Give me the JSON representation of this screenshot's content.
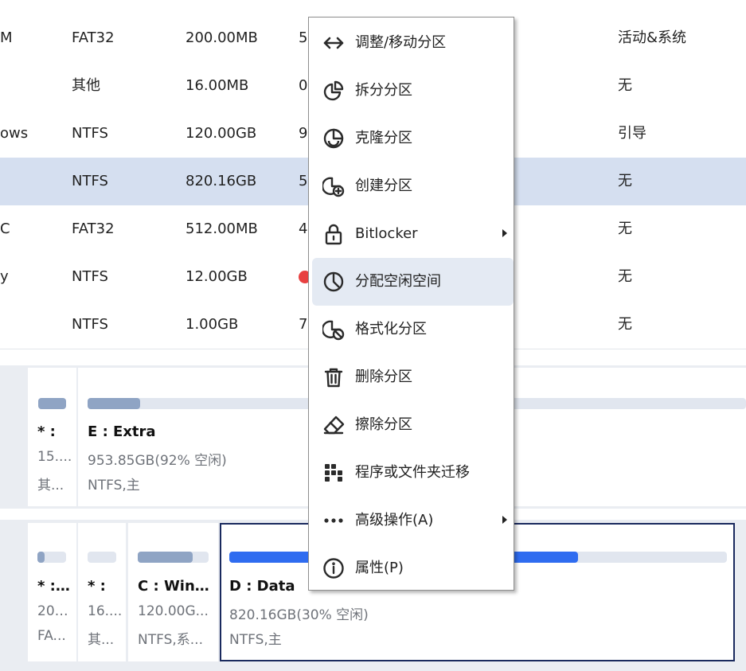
{
  "partition_table": {
    "rows": [
      {
        "name": "M",
        "fs": "FAT32",
        "size": "200.00MB",
        "used": "5",
        "type": "活动&系统",
        "selected": false
      },
      {
        "name": "",
        "fs": "其他",
        "size": "16.00MB",
        "used": "0",
        "type": "无",
        "selected": false
      },
      {
        "name": "ows",
        "fs": "NTFS",
        "size": "120.00GB",
        "used": "9",
        "type": "引导",
        "selected": false
      },
      {
        "name": "",
        "fs": "NTFS",
        "size": "820.16GB",
        "used": "5",
        "type": "无",
        "selected": true
      },
      {
        "name": "C",
        "fs": "FAT32",
        "size": "512.00MB",
        "used": "4",
        "type": "无",
        "selected": false
      },
      {
        "name": "y",
        "fs": "NTFS",
        "size": "12.00GB",
        "used": "",
        "type": "无",
        "selected": false
      },
      {
        "name": "",
        "fs": "NTFS",
        "size": "1.00GB",
        "used": "7",
        "type": "无",
        "selected": false
      }
    ]
  },
  "disk1": {
    "cards": [
      {
        "title": "* :",
        "size": "15....",
        "fs": "其...",
        "usage_fraction": 1.0
      },
      {
        "title": "E : Extra",
        "size": "953.85GB(92% 空闲)",
        "fs": "NTFS,主",
        "usage_fraction": 0.08
      }
    ]
  },
  "disk2": {
    "cards": [
      {
        "title": "* : ...",
        "size": "200....",
        "fs": "FA...",
        "usage_fraction": 0.25
      },
      {
        "title": "* :",
        "size": "16....",
        "fs": "其...",
        "usage_fraction": 0.0
      },
      {
        "title": "C : Wind...",
        "size": "120.00G...",
        "fs": "NTFS,系...",
        "usage_fraction": 0.78
      },
      {
        "title": "D : Data",
        "size": "820.16GB(30% 空闲)",
        "fs": "NTFS,主",
        "usage_fraction": 0.7
      }
    ]
  },
  "context_menu": {
    "items": [
      {
        "label": "调整/移动分区",
        "icon": "resize-move-icon",
        "submenu": false,
        "hover": false
      },
      {
        "label": "拆分分区",
        "icon": "split-partition-icon",
        "submenu": false,
        "hover": false
      },
      {
        "label": "克隆分区",
        "icon": "clone-partition-icon",
        "submenu": false,
        "hover": false
      },
      {
        "label": "创建分区",
        "icon": "create-partition-icon",
        "submenu": false,
        "hover": false
      },
      {
        "label": "Bitlocker",
        "icon": "lock-icon",
        "submenu": true,
        "hover": false
      },
      {
        "label": "分配空闲空间",
        "icon": "allocate-space-icon",
        "submenu": false,
        "hover": true
      },
      {
        "label": "格式化分区",
        "icon": "format-partition-icon",
        "submenu": false,
        "hover": false
      },
      {
        "label": "删除分区",
        "icon": "trash-icon",
        "submenu": false,
        "hover": false
      },
      {
        "label": "擦除分区",
        "icon": "eraser-icon",
        "submenu": false,
        "hover": false
      },
      {
        "label": "程序或文件夹迁移",
        "icon": "migrate-grid-icon",
        "submenu": false,
        "hover": false
      },
      {
        "label": "高级操作(A)",
        "icon": "more-dots-icon",
        "submenu": true,
        "hover": false
      },
      {
        "label": "属性(P)",
        "icon": "info-icon",
        "submenu": false,
        "hover": false
      }
    ]
  },
  "colors": {
    "selected_row": "#d5dff0",
    "menu_hover": "#e4eaf3",
    "usage_gray": "#8fa4c4",
    "usage_blue": "#2f6cf0",
    "active_border": "#1a2a5e",
    "status_red": "#e84141"
  }
}
